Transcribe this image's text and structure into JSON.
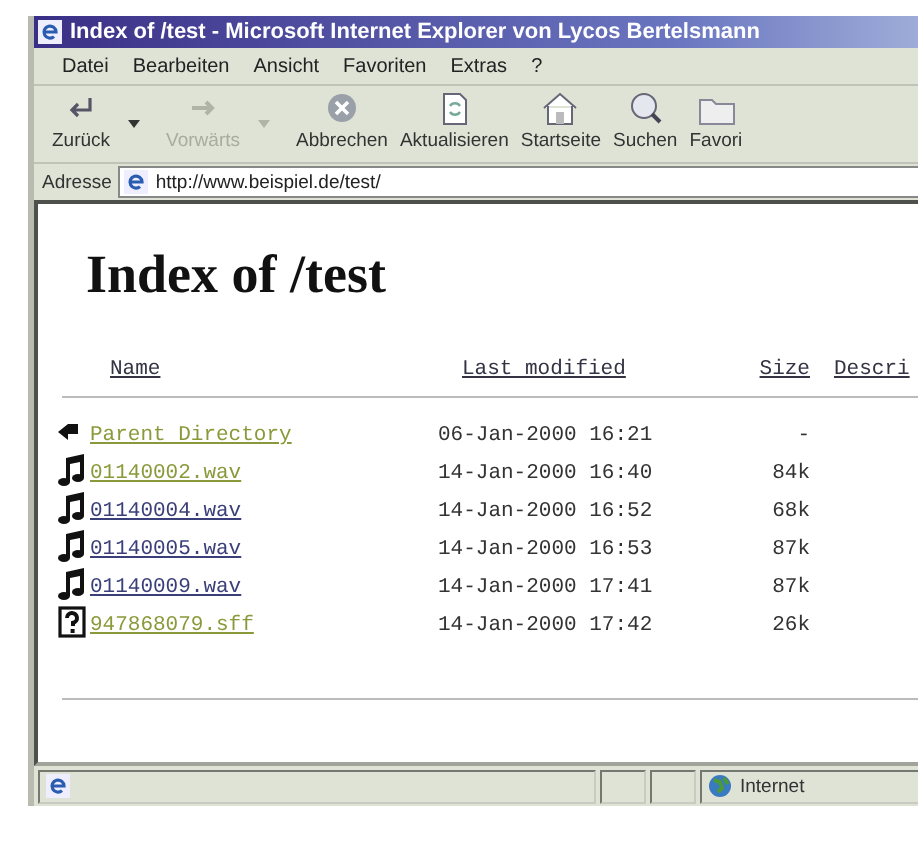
{
  "window": {
    "title": "Index of /test - Microsoft Internet Explorer von Lycos Bertelsmann"
  },
  "menu": [
    {
      "label": "Datei"
    },
    {
      "label": "Bearbeiten"
    },
    {
      "label": "Ansicht"
    },
    {
      "label": "Favoriten"
    },
    {
      "label": "Extras"
    },
    {
      "label": "?"
    }
  ],
  "toolbar": [
    {
      "kind": "back",
      "label": "Zurück",
      "disabled": false,
      "dropdown": true
    },
    {
      "kind": "forward",
      "label": "Vorwärts",
      "disabled": true,
      "dropdown": true
    },
    {
      "kind": "stop",
      "label": "Abbrechen",
      "disabled": false,
      "dropdown": false
    },
    {
      "kind": "refresh",
      "label": "Aktualisieren",
      "disabled": false,
      "dropdown": false
    },
    {
      "kind": "home",
      "label": "Startseite",
      "disabled": false,
      "dropdown": false
    },
    {
      "kind": "search",
      "label": "Suchen",
      "disabled": false,
      "dropdown": false
    },
    {
      "kind": "favorites",
      "label": "Favori",
      "disabled": false,
      "dropdown": false
    }
  ],
  "address": {
    "label": "Adresse",
    "value": "http://www.beispiel.de/test/"
  },
  "page": {
    "heading": "Index of /test",
    "columns": [
      "Name",
      "Last modified",
      "Size",
      "Descri"
    ],
    "rows": [
      {
        "kind": "parent",
        "name": "Parent Directory",
        "modified": "06-Jan-2000 16:21",
        "size": "-",
        "visited": true
      },
      {
        "kind": "sound",
        "name": "01140002.wav",
        "modified": "14-Jan-2000 16:40",
        "size": "84k",
        "visited": true
      },
      {
        "kind": "sound",
        "name": "01140004.wav",
        "modified": "14-Jan-2000 16:52",
        "size": "68k",
        "visited": false
      },
      {
        "kind": "sound",
        "name": "01140005.wav",
        "modified": "14-Jan-2000 16:53",
        "size": "87k",
        "visited": false
      },
      {
        "kind": "sound",
        "name": "01140009.wav",
        "modified": "14-Jan-2000 17:41",
        "size": "87k",
        "visited": false
      },
      {
        "kind": "unknown",
        "name": "947868079.sff",
        "modified": "14-Jan-2000 17:42",
        "size": "26k",
        "visited": true
      }
    ]
  },
  "status_bar": {
    "zone": "Internet"
  }
}
